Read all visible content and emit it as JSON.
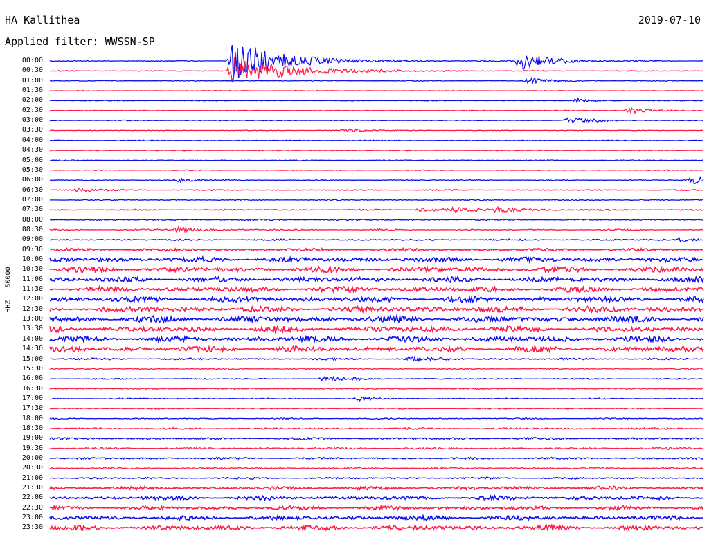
{
  "header": {
    "station": "HA Kallithea",
    "date": "2019-07-10",
    "filter": "Applied filter: WWSSN-SP"
  },
  "chart_data": {
    "type": "line",
    "title": "HA Kallithea",
    "subtitle": "Applied filter: WWSSN-SP",
    "ylabel": "HHZ - 50000",
    "row_labels": [
      "00:00",
      "00:30",
      "01:00",
      "01:30",
      "02:00",
      "02:30",
      "03:00",
      "03:30",
      "04:00",
      "04:30",
      "05:00",
      "05:30",
      "06:00",
      "06:30",
      "07:00",
      "07:30",
      "08:00",
      "08:30",
      "09:00",
      "09:30",
      "10:00",
      "10:30",
      "11:00",
      "11:30",
      "12:00",
      "12:30",
      "13:00",
      "13:30",
      "14:00",
      "14:30",
      "15:00",
      "15:30",
      "16:00",
      "16:30",
      "17:00",
      "17:30",
      "18:00",
      "18:30",
      "19:00",
      "19:30",
      "20:00",
      "20:30",
      "21:00",
      "21:30",
      "22:00",
      "22:30",
      "23:00",
      "23:30"
    ],
    "row_colors": [
      "#1010ee",
      "#ff1a4a"
    ],
    "row_noise": [
      0.5,
      0.4,
      0.35,
      0.3,
      0.3,
      0.3,
      0.35,
      0.3,
      0.35,
      0.35,
      0.4,
      0.35,
      0.45,
      0.55,
      0.55,
      0.6,
      0.65,
      0.65,
      0.7,
      1.3,
      2.2,
      2.5,
      2.4,
      2.5,
      2.6,
      2.6,
      2.7,
      2.6,
      2.6,
      2.5,
      0.9,
      0.6,
      0.55,
      0.55,
      0.5,
      0.45,
      0.55,
      0.8,
      1.0,
      0.9,
      1.0,
      0.8,
      0.9,
      1.6,
      1.8,
      1.7,
      2.0,
      2.2
    ],
    "events": [
      {
        "row": 0,
        "minute": 8.4,
        "amplitude": 32,
        "decay_min": 2.0
      },
      {
        "row": 1,
        "minute": 8.4,
        "amplitude": 20,
        "decay_min": 2.5
      },
      {
        "row": 0,
        "minute": 21.6,
        "amplitude": 14,
        "decay_min": 1.2
      },
      {
        "row": 2,
        "minute": 22.0,
        "amplitude": 5,
        "decay_min": 1.0
      },
      {
        "row": 4,
        "minute": 24.2,
        "amplitude": 3,
        "decay_min": 0.6
      },
      {
        "row": 5,
        "minute": 26.6,
        "amplitude": 4,
        "decay_min": 1.0
      },
      {
        "row": 6,
        "minute": 23.8,
        "amplitude": 5,
        "decay_min": 1.0
      },
      {
        "row": 7,
        "minute": 13.6,
        "amplitude": 3,
        "decay_min": 0.8
      },
      {
        "row": 13,
        "minute": 1.2,
        "amplitude": 3,
        "decay_min": 0.8
      },
      {
        "row": 12,
        "minute": 5.8,
        "amplitude": 3,
        "decay_min": 0.8
      },
      {
        "row": 17,
        "minute": 5.9,
        "amplitude": 4,
        "decay_min": 1.0
      },
      {
        "row": 15,
        "minute": 17.0,
        "amplitude": 2.5,
        "decay_min": 1.5
      },
      {
        "row": 15,
        "minute": 20.5,
        "amplitude": 3,
        "decay_min": 1.5
      },
      {
        "row": 15,
        "minute": 18.5,
        "amplitude": 2.5,
        "decay_min": 1.2
      },
      {
        "row": 12,
        "minute": 29.5,
        "amplitude": 6,
        "decay_min": 1.0
      },
      {
        "row": 18,
        "minute": 29.0,
        "amplitude": 3,
        "decay_min": 1.0
      },
      {
        "row": 34,
        "minute": 14.2,
        "amplitude": 2.5,
        "decay_min": 0.8
      },
      {
        "row": 32,
        "minute": 12.6,
        "amplitude": 4,
        "decay_min": 1.0
      },
      {
        "row": 30,
        "minute": 16.5,
        "amplitude": 3,
        "decay_min": 1.0
      }
    ]
  }
}
